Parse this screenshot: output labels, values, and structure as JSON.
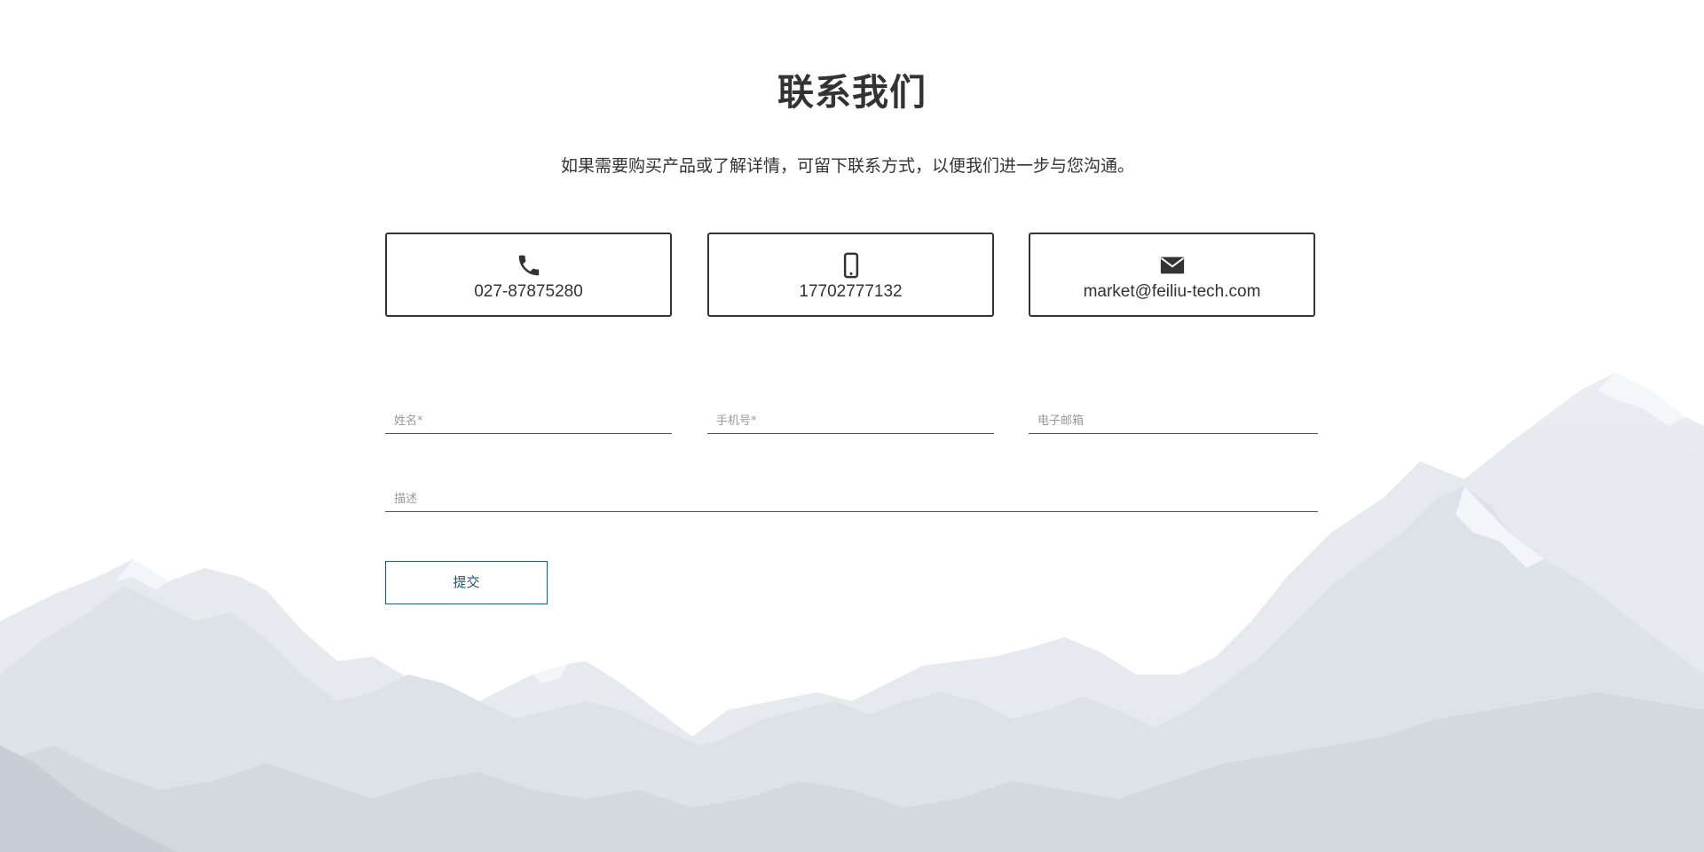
{
  "header": {
    "title": "联系我们",
    "subtitle": "如果需要购买产品或了解详情，可留下联系方式，以便我们进一步与您沟通。"
  },
  "contacts": [
    {
      "icon": "phone-icon",
      "value": "027-87875280"
    },
    {
      "icon": "mobile-phone-icon",
      "value": "17702777132"
    },
    {
      "icon": "envelope-icon",
      "value": "market@feiliu-tech.com"
    }
  ],
  "form": {
    "name_placeholder": "姓名*",
    "phone_placeholder": "手机号*",
    "email_placeholder": "电子邮箱",
    "description_placeholder": "描述",
    "submit_label": "提交"
  },
  "colors": {
    "text": "#333333",
    "submit_accent": "#1a5a9a",
    "placeholder": "#9a9a9a"
  }
}
